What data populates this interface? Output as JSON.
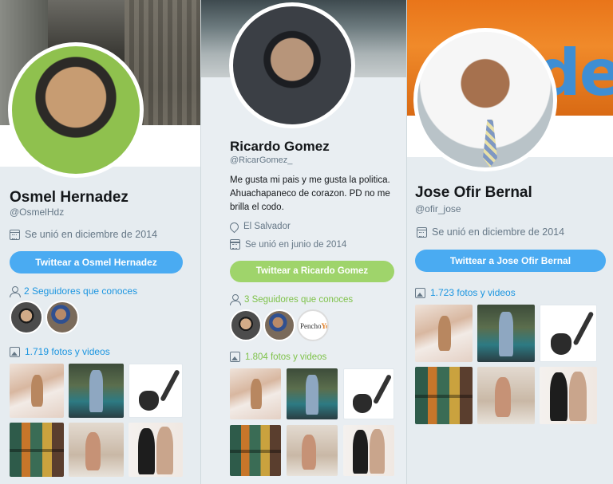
{
  "profiles": [
    {
      "name": "Osmel Hernadez",
      "handle": "@OsmelHdz",
      "joined": "Se unió en diciembre de 2014",
      "tweet_button": "Twittear a Osmel Hernadez",
      "followers_you_know": "2 Seguidores que conoces",
      "photos_videos": "1.719 fotos y videos"
    },
    {
      "name": "Ricardo Gomez",
      "handle": "@RicarGomez_",
      "bio": "Me gusta mi pais y me gusta la politica. Ahuachapaneco de corazon. PD no me brilla el codo.",
      "location": "El Salvador",
      "joined": "Se unió en junio de 2014",
      "tweet_button": "Twittear a Ricardo Gomez",
      "followers_you_know": "3 Seguidores que conoces",
      "photos_videos": "1.804 fotos y videos",
      "follower_brand": {
        "part1": "Pencho",
        "part2": "Yoda"
      }
    },
    {
      "name": "Jose Ofir Bernal",
      "handle": "@ofir_jose",
      "joined": "Se unió en diciembre de 2014",
      "tweet_button": "Twittear a Jose Ofir Bernal",
      "photos_videos": "1.723 fotos y videos",
      "banner_text": "de"
    }
  ],
  "colors": {
    "twitter_blue": "#4aabf2",
    "link_blue": "#1b95e0",
    "theme_green": "#9fd46b",
    "link_green": "#7ec249",
    "text_dark": "#14171a",
    "text_muted": "#657786"
  },
  "icons": [
    "calendar-icon",
    "location-pin-icon",
    "person-icon",
    "image-icon"
  ]
}
